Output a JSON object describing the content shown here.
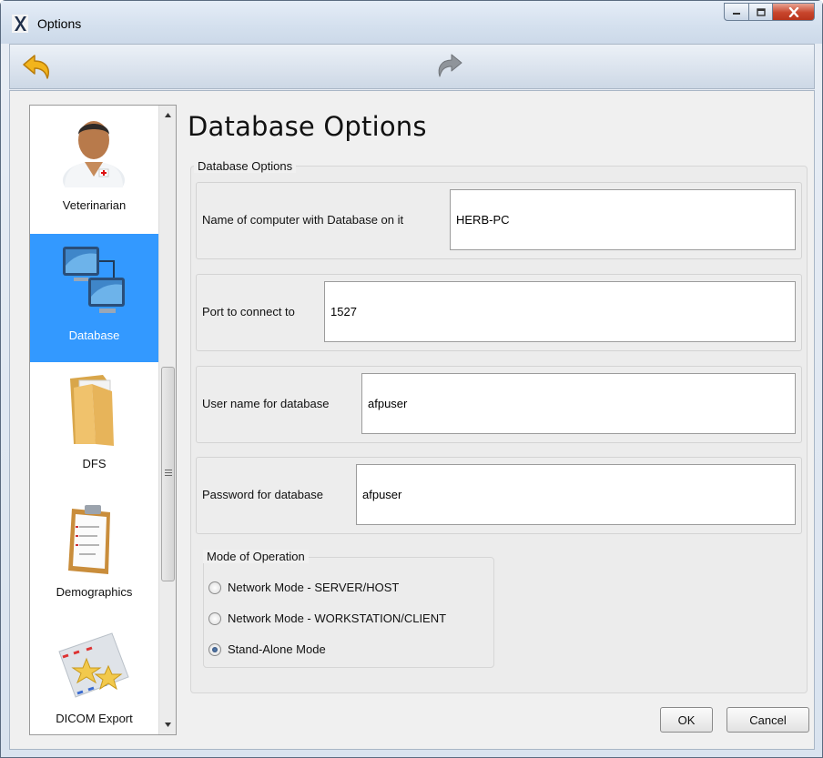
{
  "window": {
    "title": "Options"
  },
  "toolbar": {
    "back_icon": "back-arrow-icon",
    "forward_icon": "forward-arrow-icon"
  },
  "sidebar": {
    "items": [
      {
        "label": "Veterinarian",
        "icon": "veterinarian-icon",
        "active": false
      },
      {
        "label": "Database",
        "icon": "database-computers-icon",
        "active": true
      },
      {
        "label": "DFS",
        "icon": "folder-icon",
        "active": false
      },
      {
        "label": "Demographics",
        "icon": "clipboard-icon",
        "active": false
      },
      {
        "label": "DICOM Export",
        "icon": "envelope-stars-icon",
        "active": false
      }
    ]
  },
  "main": {
    "title": "Database Options",
    "group_label": "Database Options",
    "fields": [
      {
        "label": "Name of computer with Database on it",
        "value": "HERB-PC"
      },
      {
        "label": "Port to connect to",
        "value": "1527"
      },
      {
        "label": "User name for database",
        "value": "afpuser"
      },
      {
        "label": "Password for database",
        "value": "afpuser"
      }
    ],
    "mode": {
      "label": "Mode of Operation",
      "options": [
        {
          "label": "Network Mode - SERVER/HOST",
          "checked": false
        },
        {
          "label": "Network Mode - WORKSTATION/CLIENT",
          "checked": false
        },
        {
          "label": "Stand-Alone Mode",
          "checked": true
        }
      ]
    }
  },
  "buttons": {
    "ok": "OK",
    "cancel": "Cancel"
  },
  "colors": {
    "selection": "#3399ff",
    "close_button": "#c8452c"
  }
}
